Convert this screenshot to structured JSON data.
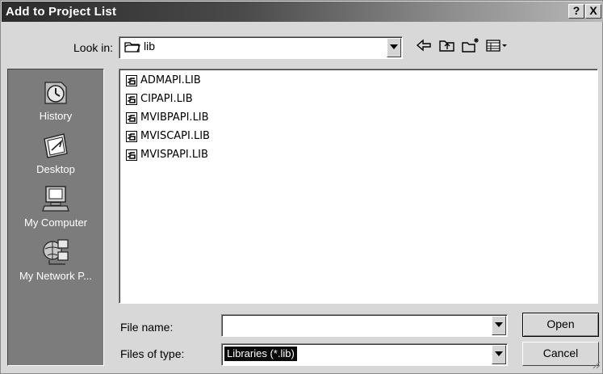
{
  "dialog": {
    "title": "Add to Project List",
    "help_label": "?",
    "close_label": "X"
  },
  "lookin": {
    "label": "Look in:",
    "value": "lib"
  },
  "toolbar": {
    "icons": [
      "back-arrow-icon",
      "up-folder-icon",
      "new-folder-icon",
      "view-menu-icon"
    ]
  },
  "places": [
    {
      "label": "History",
      "icon": "history-icon"
    },
    {
      "label": "Desktop",
      "icon": "desktop-icon"
    },
    {
      "label": "My Computer",
      "icon": "my-computer-icon"
    },
    {
      "label": "My Network P...",
      "icon": "network-places-icon"
    }
  ],
  "files": [
    "ADMAPI.LIB",
    "CIPAPI.LIB",
    "MVIBPAPI.LIB",
    "MVISCAPI.LIB",
    "MVISPAPI.LIB"
  ],
  "filename": {
    "label": "File name:",
    "value": ""
  },
  "filetype": {
    "label": "Files of type:",
    "value": "Libraries (*.lib)"
  },
  "buttons": {
    "open": "Open",
    "cancel": "Cancel"
  }
}
